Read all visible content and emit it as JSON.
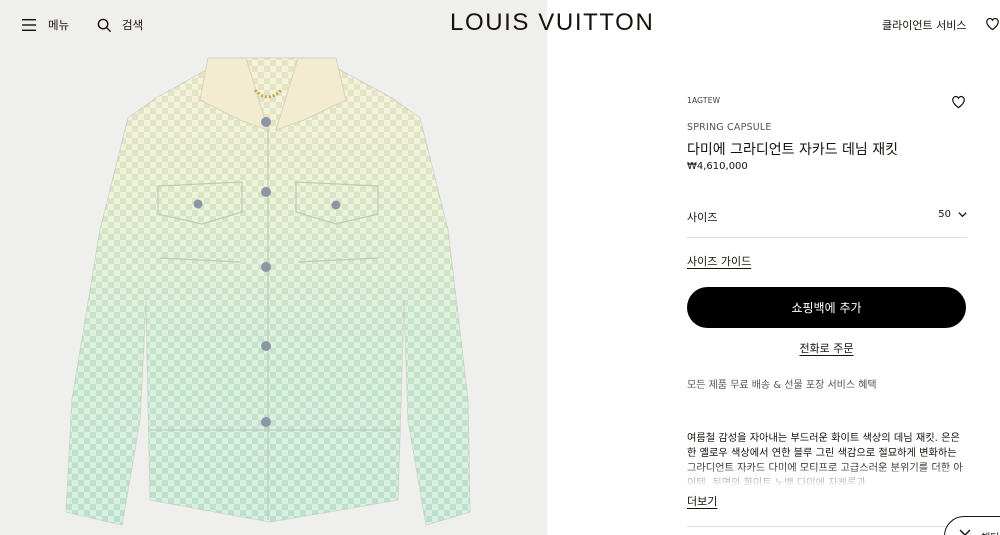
{
  "header": {
    "menu_label": "메뉴",
    "search_label": "검색",
    "brand": "LOUIS VUITTON",
    "client_service": "클라이언트 서비스"
  },
  "product": {
    "sku": "1AGTEW",
    "collection": "SPRING CAPSULE",
    "title": "다미에 그라디언트 자카드 데님 재킷",
    "price": "₩4,610,000",
    "size_label": "사이즈",
    "size_value": "50",
    "size_guide": "사이즈 가이드",
    "add_to_bag": "쇼핑백에 추가",
    "phone_order": "전화로 주문",
    "shipping_note": "모든 제품 무료 배송 & 선물 포장 서비스 혜택",
    "description": "여름철 감성을 자아내는 부드러운 화이트 색상의 데님 재킷. 은은한 옐로우 색상에서 연한 블루 그린 색감으로 절묘하게 변화하는 그라디언트 자카드 다미에 모티프로 고급스러운 분위기를 더한 아이템. 뒷면의 화이트 노백 다미에 자케론과",
    "more": "더보기"
  },
  "floating": {
    "label": "채팅"
  },
  "colors": {
    "accent": "#000000",
    "text": "#19110b",
    "image_bg": "#efefee",
    "jacket_top": "#f1e6c4",
    "jacket_bottom": "#bfe4cf"
  },
  "icons": {
    "menu": "hamburger-icon",
    "search": "search-icon",
    "wishlist": "heart-icon",
    "chevron": "chevron-down-icon"
  }
}
